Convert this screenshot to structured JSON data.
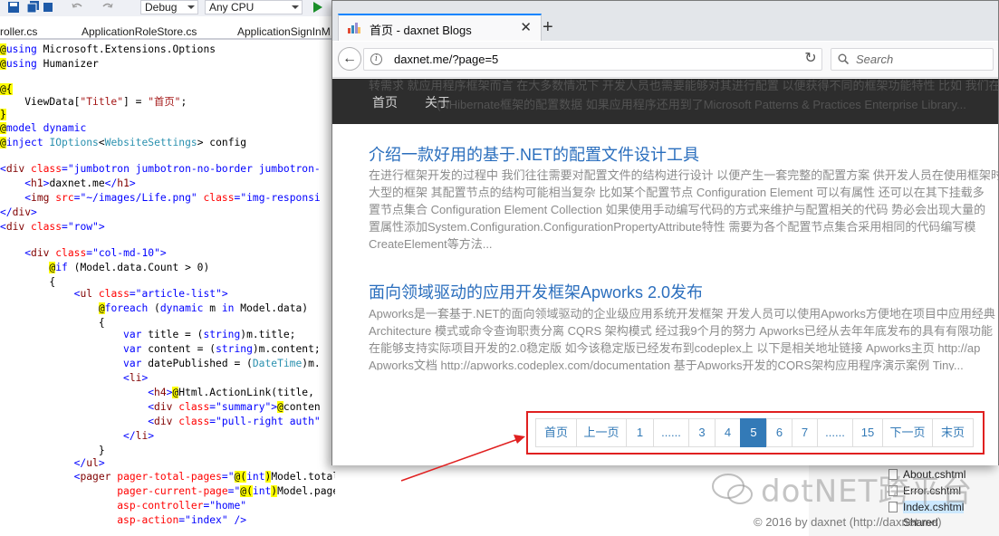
{
  "ide": {
    "toolbar": {
      "config": "Debug",
      "platform": "Any CPU"
    },
    "tabs": [
      "roller.cs",
      "ApplicationRoleStore.cs",
      "ApplicationSignInM"
    ],
    "code_lines": [
      "@using Microsoft.Extensions.Options",
      "@using Humanizer",
      "@{",
      "    ViewData[\"Title\"] = \"首页\";",
      "}",
      "@model dynamic",
      "@inject IOptions<WebsiteSettings> config",
      "<div class=\"jumbotron jumbotron-no-border jumbotron-",
      "    <h1>daxnet.me</h1>",
      "    <img src=\"~/images/Life.png\" class=\"img-responsi",
      "</div>",
      "<div class=\"row\">",
      "    <div class=\"col-md-10\">",
      "        @if (Model.data.Count > 0)",
      "        {",
      "            <ul class=\"article-list\">",
      "                @foreach (dynamic m in Model.data)",
      "                {",
      "                    var title = (string)m.title;",
      "                    var content = (string)m.content;",
      "                    var datePublished = (DateTime)m.",
      "                    <li>",
      "                        <h4>@Html.ActionLink(title,",
      "                        <div class=\"summary\">@conten",
      "                        <div class=\"pull-right auth\"",
      "                    </li>",
      "                }",
      "            </ul>",
      "            <pager pager-total-pages=\"@(int)Model.totalPages\"",
      "                   pager-current-page=\"@(int)Model.pageNumber\"",
      "                   asp-controller=\"home\"",
      "                   asp-action=\"index\" />"
    ]
  },
  "browser": {
    "tab_title": "首页 - daxnet Blogs",
    "url": "daxnet.me/?page=5",
    "search_placeholder": "Search",
    "site_header": {
      "bg_text_1": "转需求 就应用程序框架而言 在大多数情况下 开发人员也需要能够对其进行配置 以便获得不同的框架功能特性 比如 我们在",
      "bg_text_2": "(NHibernate框架的配置数据 如果应用程序还用到了Microsoft Patterns & Practices Enterprise Library...",
      "nav": [
        "首页",
        "关于"
      ]
    },
    "articles": [
      {
        "title": "介绍一款好用的基于.NET的配置文件设计工具",
        "summary": [
          "在进行框架开发的过程中 我们往往需要对配置文件的结构进行设计 以便产生一套完整的配置方案 供开发人员在使用框架时",
          "大型的框架 其配置节点的结构可能相当复杂 比如某个配置节点 Configuration Element 可以有属性 还可以在其下挂载多",
          "置节点集合 Configuration Element Collection 如果使用手动编写代码的方式来维护与配置相关的代码 势必会出现大量的",
          "置属性添加System.Configuration.ConfigurationPropertyAttribute特性 需要为各个配置节点集合采用相同的代码编写模",
          "CreateElement等方法..."
        ]
      },
      {
        "title": "面向领域驱动的应用开发框架Apworks 2.0发布",
        "summary": [
          "Apworks是一套基于.NET的面向领域驱动的企业级应用系统开发框架 开发人员可以使用Apworks方便地在项目中应用经典",
          "Architecture 模式或命令查询职责分离 CQRS 架构模式 经过我9个月的努力 Apworks已经从去年年底发布的具有有限功能",
          "在能够支持实际项目开发的2.0稳定版 如今该稳定版已经发布到codeplex上 以下是相关地址链接 Apworks主页 http://ap",
          "Apworks文档 http://apworks.codeplex.com/documentation 基于Apworks开发的CQRS架构应用程序演示案例 Tiny..."
        ]
      }
    ],
    "pager": {
      "items": [
        "首页",
        "上一页",
        "1",
        "......",
        "3",
        "4",
        "5",
        "6",
        "7",
        "......",
        "15",
        "下一页",
        "末页"
      ],
      "current": "5"
    }
  },
  "solution_explorer": {
    "items": [
      "About.cshtml",
      "Error.cshtml",
      "Index.cshtml",
      "Shared"
    ]
  },
  "watermark": "dotNET跨平台",
  "copyright": "© 2016 by daxnet (http://daxnet.me)",
  "colors": {
    "annotation": "#e02020",
    "link": "#337ab7",
    "header_bg": "#2d2d2d"
  }
}
